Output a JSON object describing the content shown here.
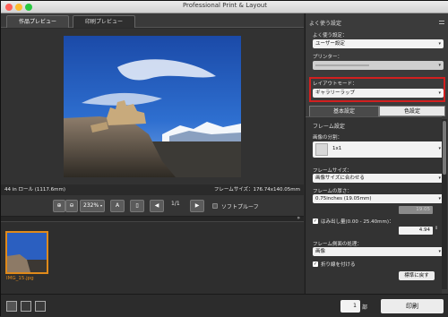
{
  "window": {
    "title": "Professional Print & Layout"
  },
  "tabs": {
    "artwork_preview": "作品プレビュー",
    "print_preview": "印刷プレビュー"
  },
  "preview": {
    "paper_label": "44 in ロール (1117.6mm)",
    "frame_size": "フレームサイズ：176.74x140.05mm"
  },
  "toolbar": {
    "zoom_value": "232%",
    "page_indicator": "1/1",
    "softproof_label": "ソフトプルーフ"
  },
  "thumbnail": {
    "filename": "IMG_15.jpg"
  },
  "panel": {
    "favorites_title": "よく使う設定",
    "favorites_label": "よく使う設定：",
    "favorites_value": "ユーザー設定",
    "printer_label": "プリンター：",
    "layout_mode_label": "レイアウトモード：",
    "layout_mode_value": "ギャラリーラップ",
    "tab_basic": "基本設定",
    "tab_color": "色設定",
    "frame_title": "フレーム設定",
    "image_split_label": "画像の分割：",
    "image_split_value": "1x1",
    "frame_size_label": "フレームサイズ：",
    "frame_size_value": "画像サイズに合わせる",
    "frame_thickness_label": "フレームの厚さ：",
    "frame_thickness_value": "0.75inches (19.05mm)",
    "frame_thickness_number": "19.05",
    "overflow_label": "はみ出し量(0.00 - 25.40mm)：",
    "overflow_number": "4.94",
    "side_treatment_label": "フレーム側面の処理：",
    "side_treatment_value": "画像",
    "foldline_label": "折り線を付ける",
    "reset_button": "標準に戻す"
  },
  "bottom": {
    "copies": "1",
    "copies_unit": "部",
    "print_button": "印刷"
  },
  "colors": {
    "accent_red": "#d21f1f",
    "selection_orange": "#e08a1a"
  },
  "checkboxes": {
    "softproof": false,
    "overflow": true,
    "foldline": true
  }
}
